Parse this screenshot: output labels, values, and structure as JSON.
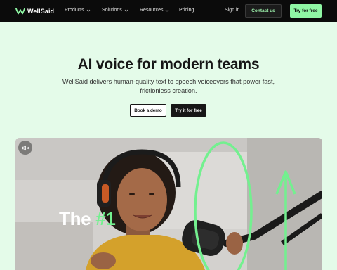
{
  "nav": {
    "brand": "WellSaid",
    "items": [
      {
        "label": "Products",
        "has_menu": true
      },
      {
        "label": "Solutions",
        "has_menu": true
      },
      {
        "label": "Resources",
        "has_menu": true
      },
      {
        "label": "Pricing",
        "has_menu": false
      }
    ],
    "sign_in": "Sign in",
    "contact": "Contact us",
    "try_free": "Try for free"
  },
  "hero": {
    "title": "AI voice for modern teams",
    "subtitle": "WellSaid delivers human-quality text to speech voiceovers that power fast, frictionless creation.",
    "demo_button": "Book a demo",
    "try_button": "Try it for free"
  },
  "video": {
    "overlay_prefix": "The",
    "overlay_accent": "#1",
    "muted": true
  },
  "colors": {
    "nav_bg": "#0b0b0b",
    "page_bg": "#e4fbe9",
    "accent_green": "#8ff7a4",
    "overlay_green": "#73f08f",
    "dark": "#161616"
  },
  "icons": [
    "wellsaid-logo-icon",
    "chevron-down-icon",
    "speaker-muted-icon"
  ]
}
